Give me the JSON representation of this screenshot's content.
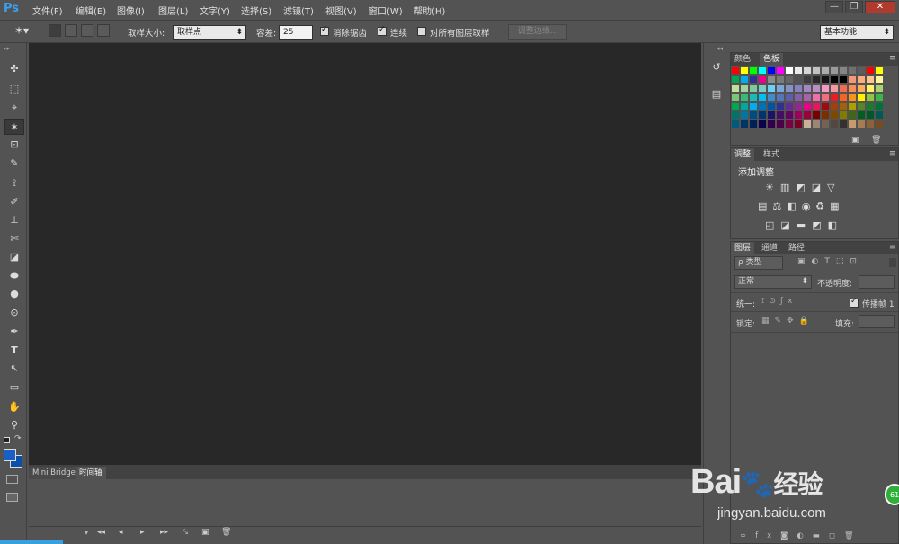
{
  "app": {
    "logo": "Ps"
  },
  "menu": [
    "文件(F)",
    "编辑(E)",
    "图像(I)",
    "图层(L)",
    "文字(Y)",
    "选择(S)",
    "滤镜(T)",
    "视图(V)",
    "窗口(W)",
    "帮助(H)"
  ],
  "window_controls": {
    "minimize": "—",
    "restore": "❐",
    "close": "✕"
  },
  "options": {
    "sample_size_label": "取样大小:",
    "sample_size_value": "取样点",
    "tolerance_label": "容差:",
    "tolerance_value": "25",
    "antialias_label": "消除锯齿",
    "contiguous_label": "连续",
    "all_layers_label": "对所有图层取样",
    "refine_edge_label": "调整边缘...",
    "workspace_value": "基本功能"
  },
  "swatches": {
    "tabs": [
      "颜色",
      "色板"
    ],
    "colors": [
      [
        "#ff0000",
        "#ffff00",
        "#00ff00",
        "#00ffff",
        "#0000ff",
        "#ff00ff",
        "#ffffff",
        "#ebebeb",
        "#d6d6d6",
        "#c2c2c2",
        "#adadad",
        "#999999",
        "#858585",
        "#707070",
        "#5c5c5c",
        "#ff0000",
        "#ffff00"
      ],
      [
        "#00a651",
        "#00aeef",
        "#2e3192",
        "#ec008c",
        "#8c8c8c",
        "#7a7a7a",
        "#666666",
        "#525252",
        "#3d3d3d",
        "#292929",
        "#141414",
        "#000000",
        "#000000",
        "#f7977a",
        "#f9ad81",
        "#fdc68a",
        "#fff79a"
      ],
      [
        "#c4df9b",
        "#a3d39c",
        "#82ca9c",
        "#7accc8",
        "#6dcff6",
        "#7da7d9",
        "#8393ca",
        "#8781bd",
        "#a187be",
        "#bc8dbf",
        "#f49ac2",
        "#f6989d",
        "#f26c4f",
        "#f68e55",
        "#fbaf5d",
        "#fff467",
        "#acd372"
      ],
      [
        "#7cc576",
        "#3bb878",
        "#1abbb4",
        "#00bff3",
        "#438ccb",
        "#5574b9",
        "#605ca8",
        "#855fa8",
        "#a763a8",
        "#f06ea9",
        "#f26d7d",
        "#ed1c24",
        "#f26522",
        "#f7941d",
        "#fff200",
        "#8dc73f",
        "#39b54a"
      ],
      [
        "#00a651",
        "#00a99d",
        "#00aeef",
        "#0072bc",
        "#0054a6",
        "#2e3192",
        "#662d91",
        "#92278f",
        "#ec008c",
        "#ed145b",
        "#9e0b0f",
        "#a0410d",
        "#a3620a",
        "#aba000",
        "#598527",
        "#197b30",
        "#007236"
      ],
      [
        "#00746b",
        "#0076a3",
        "#004b80",
        "#003471",
        "#1b1464",
        "#440e62",
        "#630460",
        "#9e005d",
        "#9e0039",
        "#790000",
        "#7b2e00",
        "#7d4900",
        "#827b00",
        "#406618",
        "#005e20",
        "#005826",
        "#005952"
      ],
      [
        "#005b7f",
        "#003663",
        "#002157",
        "#0d004c",
        "#32004b",
        "#4b0049",
        "#7b0046",
        "#7a0026",
        "#c7b299",
        "#998675",
        "#736357",
        "#534741",
        "#37302d",
        "#c69c6d",
        "#a67c52",
        "#8c6239",
        "#754c24"
      ]
    ]
  },
  "adjustments": {
    "tabs": [
      "调整",
      "样式"
    ],
    "title": "添加调整",
    "row1": [
      "☀",
      "▥",
      "◩",
      "◪",
      "▽"
    ],
    "row2": [
      "▤",
      "⚖",
      "◧",
      "◉",
      "♻",
      "▦"
    ],
    "row3": [
      "◰",
      "◪",
      "▬",
      "◩",
      "◧"
    ]
  },
  "layers": {
    "tabs": [
      "图层",
      "通道",
      "路径"
    ],
    "filter_label": "ρ 类型",
    "filter_icons": [
      "▣",
      "◐",
      "T",
      "⬚",
      "⊡"
    ],
    "blend_mode": "正常",
    "opacity_label": "不透明度:",
    "unify_label": "统一:",
    "propagate_label": "传播帧 1",
    "lock_label": "锁定:",
    "fill_label": "填充:",
    "footer_icons": [
      "∞",
      "fx",
      "◙",
      "◐",
      "▬",
      "◻",
      "🗑"
    ]
  },
  "bottom_panel": {
    "tabs": [
      "Mini Bridge",
      "时间轴"
    ],
    "controls": [
      "◂◂",
      "◂",
      "▸",
      "▸▸"
    ]
  },
  "tools": [
    "✣",
    "⬚",
    "⌖",
    "✶",
    "⊡",
    "✎",
    "⟟",
    "✐",
    "⊥",
    "✄",
    "◪",
    "⬬",
    "●",
    "⊙",
    "✒",
    "T",
    "↖",
    "▭",
    "✋",
    "⚲"
  ],
  "watermark": {
    "brand": "Bai",
    "brand2": "经验",
    "url": "jingyan.baidu.com",
    "badge": "61"
  }
}
